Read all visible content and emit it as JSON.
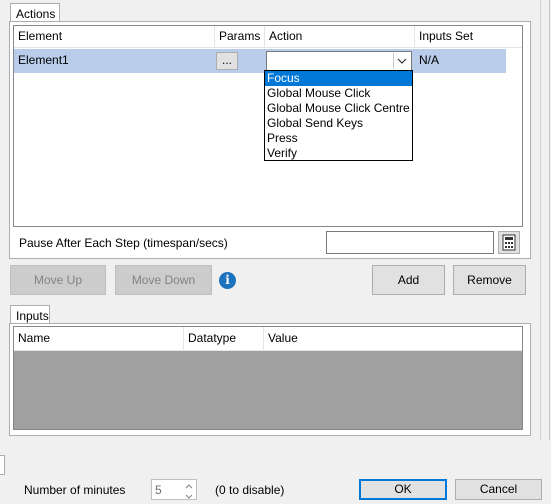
{
  "actions_panel": {
    "tab_label": "Actions",
    "columns": [
      "Element",
      "Params",
      "Action",
      "Inputs Set"
    ],
    "row": {
      "element": "Element1",
      "params_button": "...",
      "action_value": "",
      "inputs_set": "N/A"
    },
    "dropdown_options": [
      "Focus",
      "Global Mouse Click",
      "Global Mouse Click Centre",
      "Global Send Keys",
      "Press",
      "Verify"
    ],
    "selected_option": "Focus",
    "pause_label": "Pause After Each Step (timespan/secs)",
    "pause_value": ""
  },
  "buttons": {
    "move_up": "Move Up",
    "move_down": "Move Down",
    "info_icon_glyph": "i",
    "add": "Add",
    "remove": "Remove"
  },
  "inputs_panel": {
    "tab_label": "Inputs",
    "columns": [
      "Name",
      "Datatype",
      "Value"
    ]
  },
  "footer": {
    "minutes_label": "Number of minutes",
    "minutes_value": "5",
    "minutes_hint": "(0 to disable)",
    "ok": "OK",
    "cancel": "Cancel"
  },
  "colors": {
    "selected_row": "#b9cce9",
    "dropdown_highlight": "#0078d7",
    "info_icon": "#1e73be",
    "empty_grid": "#a0a0a0"
  }
}
